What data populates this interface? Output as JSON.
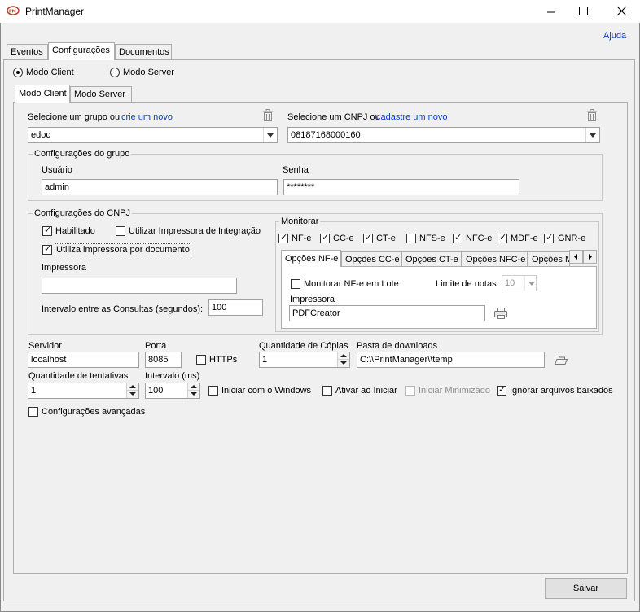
{
  "window": {
    "title": "PrintManager",
    "help_link": "Ajuda"
  },
  "main_tabs": [
    "Eventos",
    "Configurações",
    "Documentos"
  ],
  "mode": {
    "client_label": "Modo Client",
    "server_label": "Modo Server",
    "selected": "client"
  },
  "sub_tabs": [
    "Modo Client",
    "Modo Server"
  ],
  "group_select": {
    "label": "Selecione um grupo ou",
    "link": "crie um novo",
    "value": "edoc"
  },
  "cnpj_select": {
    "label": "Selecione um CNPJ ou",
    "link": "cadastre um novo",
    "value": "08187168000160"
  },
  "group_config": {
    "title": "Configurações do grupo",
    "user_label": "Usuário",
    "user_value": "admin",
    "password_label": "Senha",
    "password_value": "********"
  },
  "cnpj_config": {
    "title": "Configurações do CNPJ",
    "enabled_label": "Habilitado",
    "integration_label": "Utilizar Impressora de Integração",
    "per_doc_label": "Utiliza impressora por documento",
    "printer_label": "Impressora",
    "printer_value": "",
    "interval_label": "Intervalo entre as Consultas (segundos):",
    "interval_value": "100"
  },
  "monitor": {
    "title": "Monitorar",
    "items": [
      {
        "label": "NF-e",
        "checked": true
      },
      {
        "label": "CC-e",
        "checked": true
      },
      {
        "label": "CT-e",
        "checked": true
      },
      {
        "label": "NFS-e",
        "checked": false
      },
      {
        "label": "NFC-e",
        "checked": true
      },
      {
        "label": "MDF-e",
        "checked": true
      },
      {
        "label": "GNR-e",
        "checked": true
      }
    ],
    "tabs": [
      "Opções NF-e",
      "Opções CC-e",
      "Opções CT-e",
      "Opções NFC-e",
      "Opções M"
    ],
    "lote_label": "Monitorar NF-e em Lote",
    "limit_label": "Limite de notas:",
    "limit_value": "10",
    "printer_label": "Impressora",
    "printer_value": "PDFCreator"
  },
  "server": {
    "server_label": "Servidor",
    "server_value": "localhost",
    "port_label": "Porta",
    "port_value": "8085",
    "https_label": "HTTPs",
    "copies_label": "Quantidade de Cópias",
    "copies_value": "1",
    "downloads_label": "Pasta de downloads",
    "downloads_value": "C:\\\\PrintManager\\\\temp",
    "retries_label": "Quantidade de tentativas",
    "retries_value": "1",
    "interval_label": "Intervalo (ms)",
    "interval_value": "100",
    "start_windows_label": "Iniciar com o Windows",
    "activate_label": "Ativar ao Iniciar",
    "minimized_label": "Iniciar Minimizado",
    "ignore_label": "Ignorar arquivos baixados",
    "advanced_label": "Configurações avançadas"
  },
  "footer": {
    "save_label": "Salvar"
  }
}
